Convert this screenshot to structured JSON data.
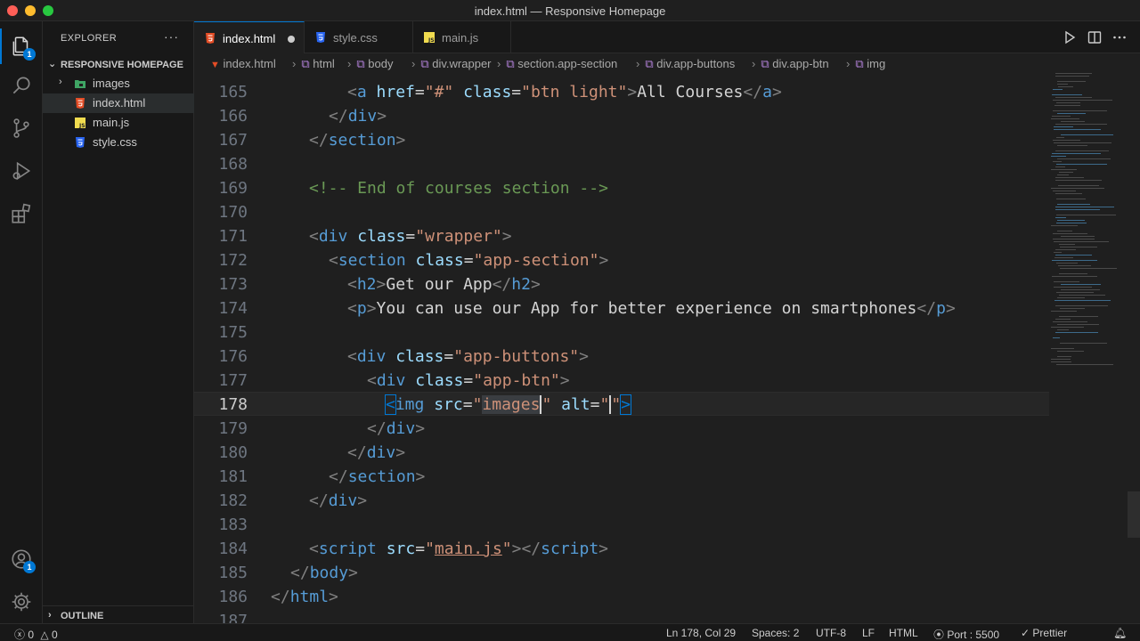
{
  "window": {
    "title": "index.html — Responsive Homepage"
  },
  "activity": {
    "explorer_badge": "1",
    "accounts_badge": "1"
  },
  "sidebar": {
    "title": "EXPLORER",
    "more": "···",
    "project": "RESPONSIVE HOMEPAGE",
    "items": [
      {
        "label": "images",
        "icon": "folder-icon"
      },
      {
        "label": "index.html",
        "icon": "html-file-icon"
      },
      {
        "label": "main.js",
        "icon": "js-file-icon"
      },
      {
        "label": "style.css",
        "icon": "css-file-icon"
      }
    ],
    "outline": "OUTLINE"
  },
  "tabs": [
    {
      "label": "index.html",
      "active": true,
      "modified": true
    },
    {
      "label": "style.css"
    },
    {
      "label": "main.js"
    }
  ],
  "breadcrumb": [
    "index.html",
    "html",
    "body",
    "div.wrapper",
    "section.app-section",
    "div.app-buttons",
    "div.app-btn",
    "img"
  ],
  "editor": {
    "current_line": "178",
    "lines": [
      {
        "n": "165"
      },
      {
        "n": "166"
      },
      {
        "n": "167"
      },
      {
        "n": "168"
      },
      {
        "n": "169"
      },
      {
        "n": "170"
      },
      {
        "n": "171"
      },
      {
        "n": "172"
      },
      {
        "n": "173"
      },
      {
        "n": "174"
      },
      {
        "n": "175"
      },
      {
        "n": "176"
      },
      {
        "n": "177"
      },
      {
        "n": "178"
      },
      {
        "n": "179"
      },
      {
        "n": "180"
      },
      {
        "n": "181"
      },
      {
        "n": "182"
      },
      {
        "n": "183"
      },
      {
        "n": "184"
      },
      {
        "n": "185"
      },
      {
        "n": "186"
      },
      {
        "n": "187"
      }
    ],
    "code": {
      "l165": {
        "tag_a": "a",
        "attr_href": "href",
        "val_href": "\"#\"",
        "attr_class": "class",
        "val_class": "\"btn light\"",
        "text": "All Courses",
        "close_a": "a"
      },
      "l166": {
        "close": "div"
      },
      "l167": {
        "close": "section"
      },
      "l169": {
        "comment": "<!-- End of courses section -->"
      },
      "l171": {
        "tag": "div",
        "attr": "class",
        "val": "\"wrapper\""
      },
      "l172": {
        "tag": "section",
        "attr": "class",
        "val": "\"app-section\""
      },
      "l173": {
        "tag": "h2",
        "text": "Get our App",
        "close": "h2"
      },
      "l174": {
        "tag": "p",
        "text": "You can use our App for better experience on smartphones",
        "close": "p"
      },
      "l176": {
        "tag": "div",
        "attr": "class",
        "val": "\"app-buttons\""
      },
      "l177": {
        "tag": "div",
        "attr": "class",
        "val": "\"app-btn\""
      },
      "l178": {
        "tag": "img",
        "attr_src": "src",
        "q1": "\"",
        "val_src": "images",
        "q2": "\"",
        "attr_alt": "alt",
        "val_alt_open": "\"",
        "val_alt_close": "\""
      },
      "l179": {
        "close": "div"
      },
      "l180": {
        "close": "div"
      },
      "l181": {
        "close": "section"
      },
      "l182": {
        "close": "div"
      },
      "l184": {
        "tag": "script",
        "attr": "src",
        "val": "main.js",
        "close": "script"
      },
      "l185": {
        "close": "body"
      },
      "l186": {
        "close": "html"
      }
    }
  },
  "status": {
    "errors": "0",
    "warnings": "0",
    "position": "Ln 178, Col 29",
    "spaces": "Spaces: 2",
    "encoding": "UTF-8",
    "eol": "LF",
    "language": "HTML",
    "port": "Port : 5500",
    "formatter": "Prettier"
  },
  "colors": {
    "accent": "#0078d4",
    "tag": "#569cd6",
    "attr": "#9cdcfe",
    "string": "#ce9178",
    "comment": "#6a9955"
  }
}
